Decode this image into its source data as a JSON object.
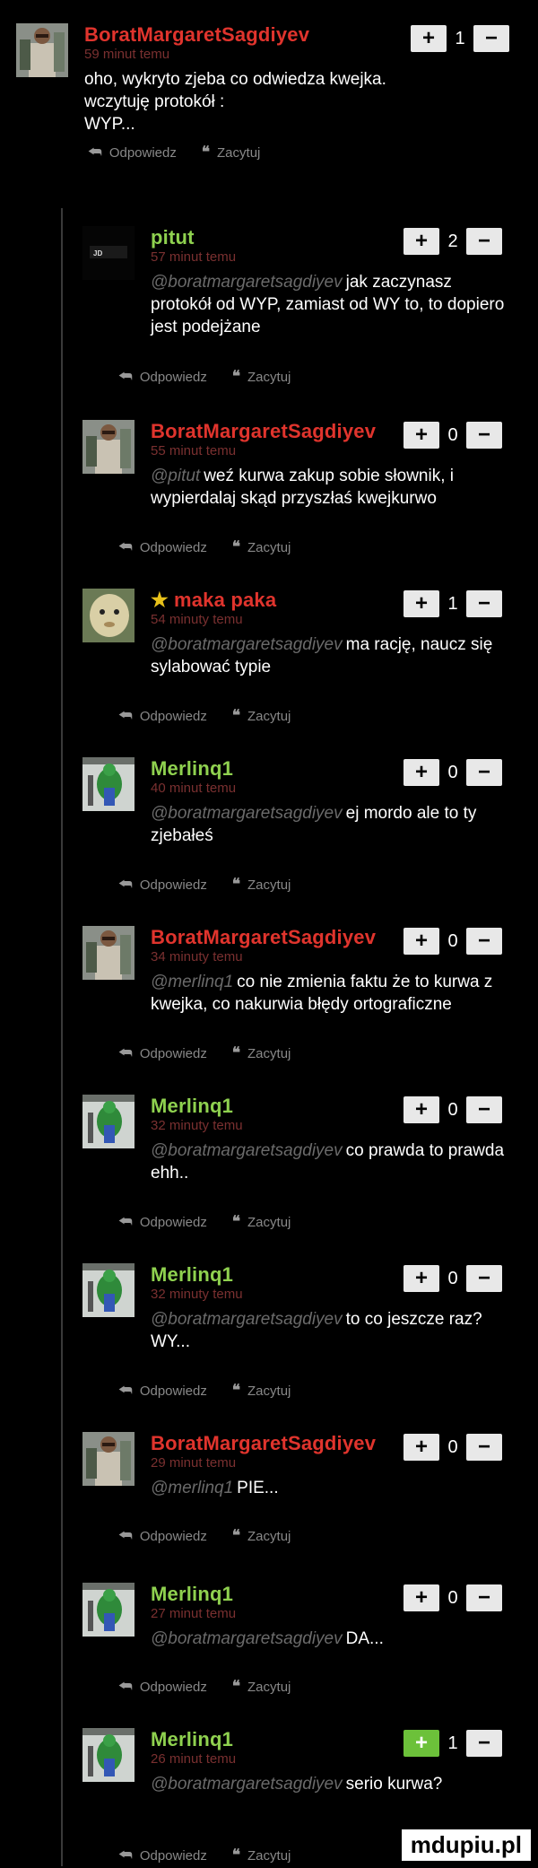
{
  "actions": {
    "reply": "Odpowiedz",
    "quote": "Zacytuj"
  },
  "colors": {
    "red_author": "#e0342d",
    "green_author": "#8fd14f",
    "yellow_author": "#e8c11a",
    "upvote_active": "#6cc13a"
  },
  "comments": [
    {
      "author": "BoratMargaretSagdiyev",
      "author_color": "#e0342d",
      "time": "59 minut temu",
      "mention": "",
      "text": "oho, wykryto zjeba co odwiedza kwejka.\nwczytuję protokół :\nWYP...",
      "score": "1",
      "upvoted": false,
      "avatar": "borat"
    },
    {
      "author": "pitut",
      "author_color": "#8fd14f",
      "time": "57 minut temu",
      "mention": "@boratmargaretsagdiyev",
      "text": "jak zaczynasz protokół od WYP, zamiast od WY to, to dopiero jest podejżane",
      "score": "2",
      "upvoted": false,
      "avatar": "pitut"
    },
    {
      "author": "BoratMargaretSagdiyev",
      "author_color": "#e0342d",
      "time": "55 minut temu",
      "mention": "@pitut",
      "text": "weź kurwa zakup sobie słownik, i wypierdalaj skąd przyszłaś kwejkurwo",
      "score": "0",
      "upvoted": false,
      "avatar": "borat"
    },
    {
      "author": "maka paka",
      "author_color": "#e0342d",
      "star": "★",
      "time": "54 minuty temu",
      "mention": "@boratmargaretsagdiyev",
      "text": "ma rację, naucz się sylabować typie",
      "score": "1",
      "upvoted": false,
      "avatar": "maka"
    },
    {
      "author": "Merlinq1",
      "author_color": "#8fd14f",
      "time": "40 minut temu",
      "mention": "@boratmargaretsagdiyev",
      "text": "ej mordo ale to ty zjebałeś",
      "score": "0",
      "upvoted": false,
      "avatar": "merlin"
    },
    {
      "author": "BoratMargaretSagdiyev",
      "author_color": "#e0342d",
      "time": "34 minuty temu",
      "mention": "@merlinq1",
      "text": "co nie zmienia faktu że to kurwa z kwejka, co nakurwia błędy ortograficzne",
      "score": "0",
      "upvoted": false,
      "avatar": "borat"
    },
    {
      "author": "Merlinq1",
      "author_color": "#8fd14f",
      "time": "32 minuty temu",
      "mention": "@boratmargaretsagdiyev",
      "text": "co prawda to prawda ehh..",
      "score": "0",
      "upvoted": false,
      "avatar": "merlin"
    },
    {
      "author": "Merlinq1",
      "author_color": "#8fd14f",
      "time": "32 minuty temu",
      "mention": "@boratmargaretsagdiyev",
      "text": "to co jeszcze raz? WY...",
      "score": "0",
      "upvoted": false,
      "avatar": "merlin"
    },
    {
      "author": "BoratMargaretSagdiyev",
      "author_color": "#e0342d",
      "time": "29 minut temu",
      "mention": "@merlinq1",
      "text": "PIE...",
      "score": "0",
      "upvoted": false,
      "avatar": "borat"
    },
    {
      "author": "Merlinq1",
      "author_color": "#8fd14f",
      "time": "27 minut temu",
      "mention": "@boratmargaretsagdiyev",
      "text": "DA...",
      "score": "0",
      "upvoted": false,
      "avatar": "merlin"
    },
    {
      "author": "Merlinq1",
      "author_color": "#8fd14f",
      "time": "26 minut temu",
      "mention": "@boratmargaretsagdiyev",
      "text": "serio kurwa?",
      "score": "1",
      "upvoted": true,
      "avatar": "merlin"
    }
  ],
  "watermark": "mdupiu.pl"
}
